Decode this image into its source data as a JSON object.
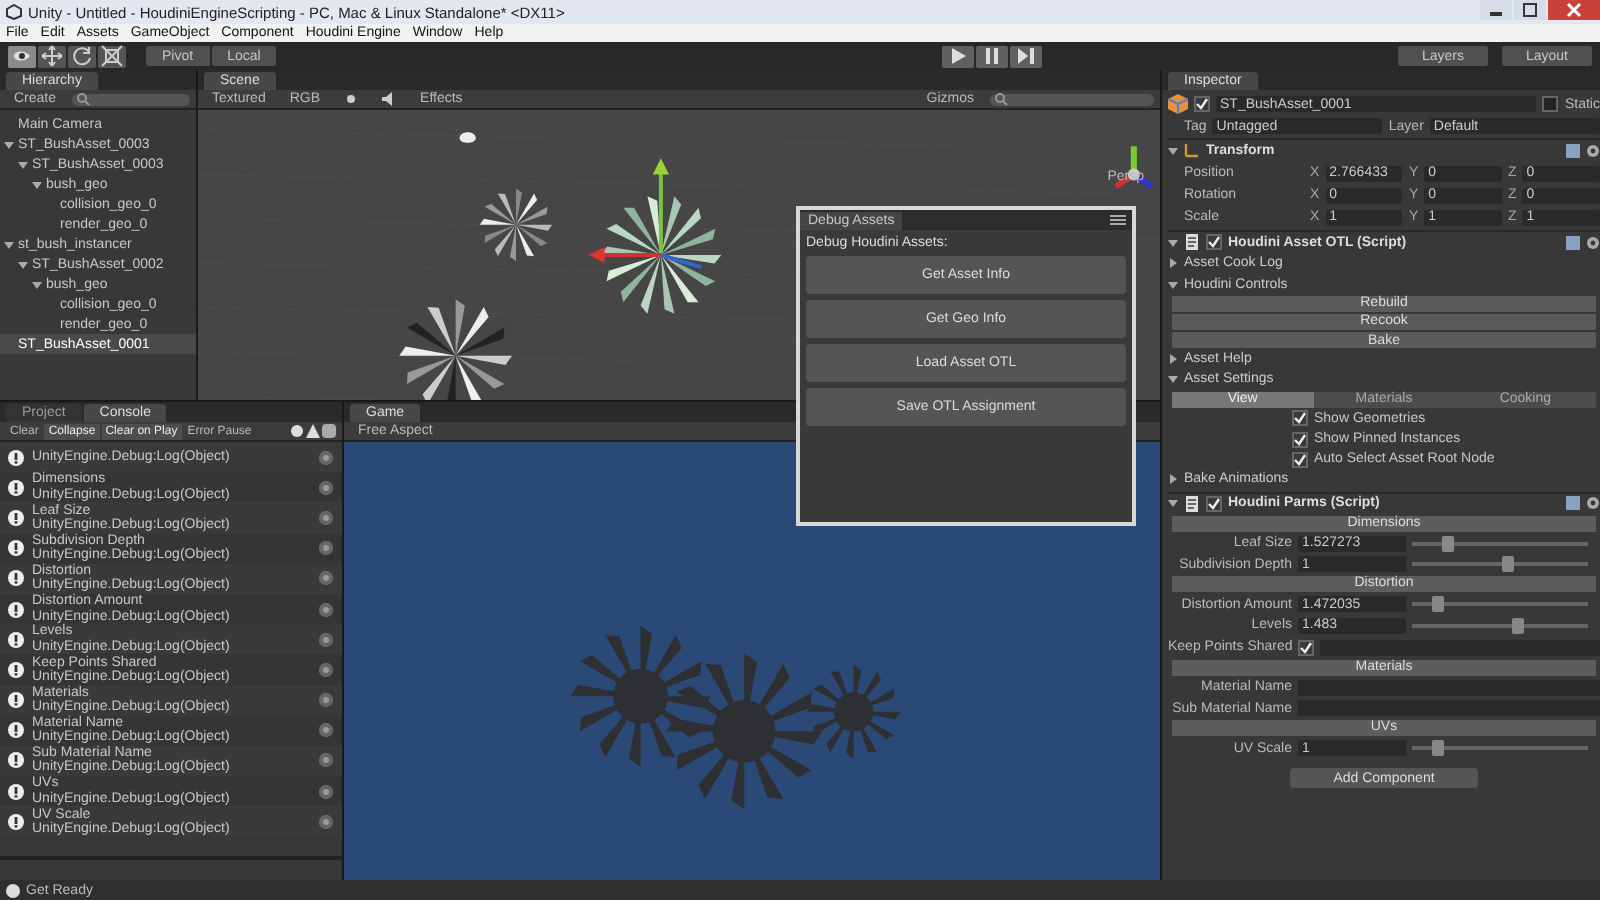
{
  "window": {
    "title": "Unity - Untitled - HoudiniEngineScripting - PC, Mac & Linux Standalone* <DX11>"
  },
  "menu": [
    "File",
    "Edit",
    "Assets",
    "GameObject",
    "Component",
    "Houdini Engine",
    "Window",
    "Help"
  ],
  "toolbar": {
    "tools": [
      {
        "kind": "hand",
        "selected": true
      },
      {
        "kind": "move",
        "selected": false
      },
      {
        "kind": "rotate",
        "selected": false
      },
      {
        "kind": "scale",
        "selected": false
      }
    ],
    "pivot": "Pivot",
    "space": "Local",
    "layers": "Layers",
    "layout": "Layout"
  },
  "hierarchy": {
    "tab": "Hierarchy",
    "create": "Create",
    "items": [
      {
        "label": "Main Camera",
        "selected": false
      },
      {
        "label": "ST_BushAsset_0003",
        "selected": false,
        "expanded": true,
        "children": [
          {
            "label": "ST_BushAsset_0003",
            "selected": false,
            "expanded": true,
            "children": [
              {
                "label": "bush_geo",
                "selected": false,
                "expanded": true,
                "children": [
                  {
                    "label": "collision_geo_0",
                    "selected": false
                  },
                  {
                    "label": "render_geo_0",
                    "selected": false
                  }
                ]
              }
            ]
          }
        ]
      },
      {
        "label": "st_bush_instancer",
        "selected": false,
        "expanded": true,
        "children": [
          {
            "label": "ST_BushAsset_0002",
            "selected": false,
            "expanded": true,
            "children": [
              {
                "label": "bush_geo",
                "selected": false,
                "expanded": true,
                "children": [
                  {
                    "label": "collision_geo_0",
                    "selected": false
                  },
                  {
                    "label": "render_geo_0",
                    "selected": false
                  }
                ]
              }
            ]
          }
        ]
      },
      {
        "label": "ST_BushAsset_0001",
        "selected": true
      }
    ]
  },
  "scene": {
    "tab": "Scene",
    "shading": "Textured",
    "mode": "RGB",
    "effects": "Effects",
    "gizmos": "Gizmos",
    "persp": "Persp"
  },
  "debug_window": {
    "title": "Debug Assets",
    "heading": "Debug Houdini Assets:",
    "buttons": [
      "Get Asset Info",
      "Get Geo Info",
      "Load Asset OTL",
      "Save OTL Assignment"
    ]
  },
  "console": {
    "tabs": [
      {
        "label": "Project",
        "selected": false
      },
      {
        "label": "Console",
        "selected": true
      }
    ],
    "toggles": [
      {
        "label": "Clear",
        "on": false
      },
      {
        "label": "Collapse",
        "on": true
      },
      {
        "label": "Clear on Play",
        "on": true
      },
      {
        "label": "Error Pause",
        "on": false
      }
    ],
    "entries": [
      {
        "source": "UnityEngine.Debug:Log(Object)"
      },
      {
        "message": "Dimensions",
        "source": "UnityEngine.Debug:Log(Object)"
      },
      {
        "message": "Leaf Size",
        "source": "UnityEngine.Debug:Log(Object)"
      },
      {
        "message": "Subdivision Depth",
        "source": "UnityEngine.Debug:Log(Object)"
      },
      {
        "message": "Distortion",
        "source": "UnityEngine.Debug:Log(Object)"
      },
      {
        "message": "Distortion Amount",
        "source": "UnityEngine.Debug:Log(Object)"
      },
      {
        "message": "Levels",
        "source": "UnityEngine.Debug:Log(Object)"
      },
      {
        "message": "Keep Points Shared",
        "source": "UnityEngine.Debug:Log(Object)"
      },
      {
        "message": "Materials",
        "source": "UnityEngine.Debug:Log(Object)"
      },
      {
        "message": "Material Name",
        "source": "UnityEngine.Debug:Log(Object)"
      },
      {
        "message": "Sub Material Name",
        "source": "UnityEngine.Debug:Log(Object)"
      },
      {
        "message": "UVs",
        "source": "UnityEngine.Debug:Log(Object)"
      },
      {
        "message": "UV Scale",
        "source": "UnityEngine.Debug:Log(Object)"
      }
    ]
  },
  "game": {
    "tab": "Game",
    "aspect": "Free Aspect"
  },
  "inspector": {
    "tab": "Inspector",
    "active": true,
    "name": "ST_BushAsset_0001",
    "static_label": "Static",
    "static": false,
    "tag_label": "Tag",
    "tag": "Untagged",
    "layer_label": "Layer",
    "layer": "Default",
    "transform": {
      "title": "Transform",
      "rows": [
        {
          "label": "Position",
          "axes": [
            "X",
            "Y",
            "Z"
          ],
          "values": [
            "2.766433",
            "0",
            "0"
          ]
        },
        {
          "label": "Rotation",
          "axes": [
            "X",
            "Y",
            "Z"
          ],
          "values": [
            "0",
            "0",
            "0"
          ]
        },
        {
          "label": "Scale",
          "axes": [
            "X",
            "Y",
            "Z"
          ],
          "values": [
            "1",
            "1",
            "1"
          ]
        }
      ]
    },
    "asset": {
      "title": "Houdini Asset OTL (Script)",
      "enabled": true,
      "sections": [
        {
          "label": "Asset Cook Log",
          "expanded": false
        },
        {
          "label": "Houdini Controls",
          "expanded": true,
          "buttons": [
            "Rebuild",
            "Recook",
            "Bake"
          ]
        },
        {
          "label": "Asset Help",
          "expanded": false
        },
        {
          "label": "Asset Settings",
          "expanded": true,
          "tabs": [
            {
              "label": "View",
              "selected": true
            },
            {
              "label": "Materials",
              "selected": false
            },
            {
              "label": "Cooking",
              "selected": false
            }
          ],
          "checks": [
            {
              "label": "Show Geometries",
              "checked": true
            },
            {
              "label": "Show Pinned Instances",
              "checked": true
            },
            {
              "label": "Auto Select Asset Root Node",
              "checked": true
            }
          ]
        },
        {
          "label": "Bake Animations",
          "expanded": false
        }
      ]
    },
    "parms": {
      "title": "Houdini Parms (Script)",
      "enabled": true,
      "rows": [
        {
          "kind": "header",
          "label": "Dimensions"
        },
        {
          "kind": "slider",
          "label": "Leaf Size",
          "value": "1.527273",
          "level": 0.2
        },
        {
          "kind": "slider",
          "label": "Subdivision Depth",
          "value": "1",
          "level": 0.55
        },
        {
          "kind": "header",
          "label": "Distortion"
        },
        {
          "kind": "slider",
          "label": "Distortion Amount",
          "value": "1.472035",
          "level": 0.15
        },
        {
          "kind": "slider",
          "label": "Levels",
          "value": "1.483",
          "level": 0.6
        },
        {
          "kind": "toggle",
          "label": "Keep Points Shared",
          "checked": true
        },
        {
          "kind": "header",
          "label": "Materials"
        },
        {
          "kind": "text",
          "label": "Material Name"
        },
        {
          "kind": "text",
          "label": "Sub Material Name"
        },
        {
          "kind": "header",
          "label": "UVs"
        },
        {
          "kind": "slider",
          "label": "UV Scale",
          "value": "1",
          "level": 0.15
        }
      ]
    },
    "add_component": "Add Component"
  },
  "status_bar": {
    "text": "Get Ready"
  }
}
